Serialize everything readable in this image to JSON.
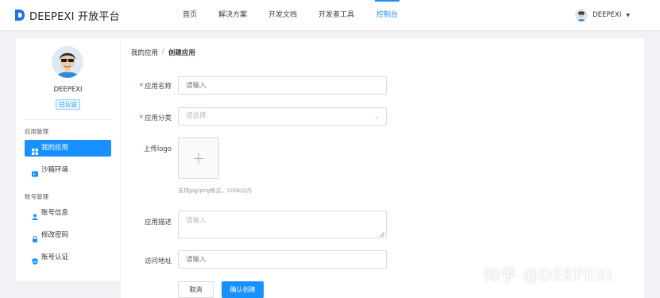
{
  "brand": {
    "name": "DEEPEXI 开放平台",
    "accent": "#1890ff"
  },
  "nav": {
    "items": [
      {
        "label": "首页"
      },
      {
        "label": "解决方案"
      },
      {
        "label": "开发文档"
      },
      {
        "label": "开发者工具"
      },
      {
        "label": "控制台",
        "active": true
      }
    ]
  },
  "user": {
    "name": "DEEPEXI",
    "avatar_icon": "avatar-icon",
    "dropdown_icon": "caret-down-icon"
  },
  "sidebar": {
    "profile_name": "DEEPEXI",
    "verified_badge": "已认证",
    "groups": [
      {
        "title": "应用管理",
        "items": [
          {
            "label": "我的应用",
            "icon": "grid-icon",
            "active": true
          },
          {
            "label": "沙箱环境",
            "icon": "sandbox-icon"
          }
        ]
      },
      {
        "title": "账号管理",
        "items": [
          {
            "label": "账号信息",
            "icon": "user-icon"
          },
          {
            "label": "修改密码",
            "icon": "lock-icon"
          },
          {
            "label": "账号认证",
            "icon": "shield-icon"
          }
        ]
      }
    ]
  },
  "breadcrumb": {
    "parent": "我的应用",
    "separator": "/",
    "current": "创建应用"
  },
  "form": {
    "app_name": {
      "label": "应用名称",
      "required": true,
      "placeholder": "请输入",
      "value": ""
    },
    "app_category": {
      "label": "应用分类",
      "required": true,
      "placeholder": "请选择",
      "value": ""
    },
    "logo": {
      "label": "上传logo",
      "hint": "支持jpg/png格式，100k以内"
    },
    "description": {
      "label": "应用描述",
      "placeholder": "请输入",
      "value": ""
    },
    "url": {
      "label": "访问地址",
      "placeholder": "请输入",
      "value": ""
    }
  },
  "actions": {
    "cancel": "取消",
    "confirm": "确认创建"
  },
  "watermark": "知乎 @DEEPEXI"
}
